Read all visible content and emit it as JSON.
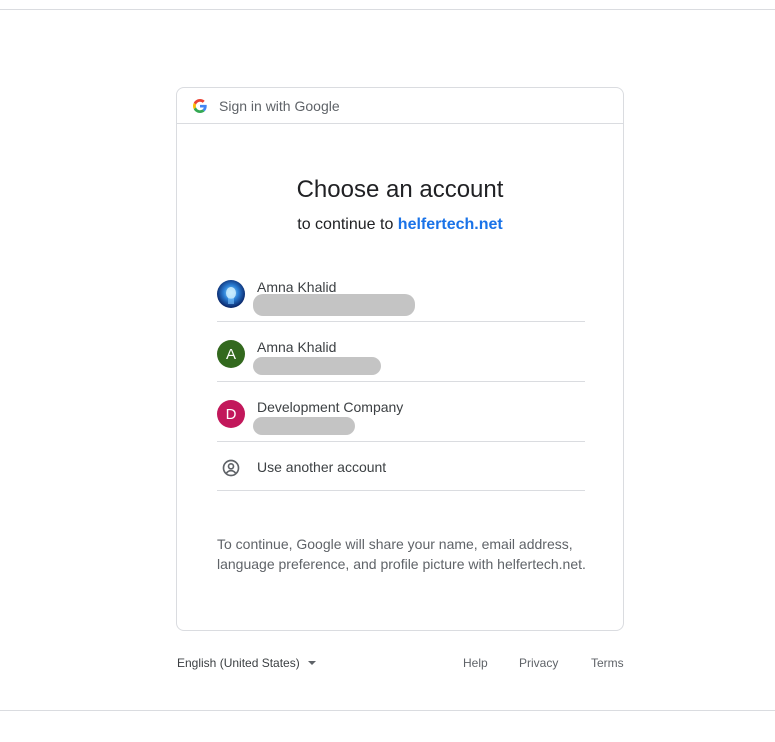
{
  "header": {
    "title": "Sign in with Google"
  },
  "main": {
    "title": "Choose an account",
    "subtitle_prefix": "to continue to",
    "site": "helfertech.net"
  },
  "accounts": [
    {
      "name": "Amna Khalid",
      "avatar": "photo"
    },
    {
      "name": "Amna Khalid",
      "avatar_letter": "A",
      "avatar_color": "#33691e"
    },
    {
      "name": "Development Company",
      "avatar_letter": "D",
      "avatar_color": "#c2185b"
    }
  ],
  "use_another": {
    "label": "Use another account",
    "icon": "account-circle-icon"
  },
  "disclaimer": "To continue, Google will share your name, email address, language preference, and profile picture with helfertech.net.",
  "footer": {
    "language": "English (United States)",
    "help": "Help",
    "privacy": "Privacy",
    "terms": "Terms"
  },
  "colors": {
    "link_blue": "#1a73e8",
    "border": "#dadce0",
    "text_secondary": "#5f6368"
  }
}
